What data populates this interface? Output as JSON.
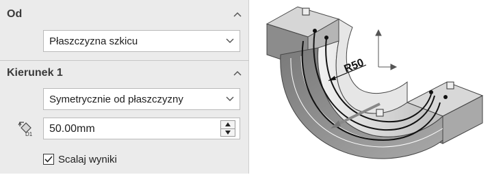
{
  "from_section": {
    "title": "Od",
    "start_condition": "Płaszczyzna szkicu"
  },
  "direction1_section": {
    "title": "Kierunek 1",
    "end_condition": "Symetrycznie od płaszczyzny",
    "depth_value": "50.00mm",
    "depth_icon_label": "D1"
  },
  "merge_result": {
    "label": "Scalaj wyniki",
    "checked": true
  },
  "model_view": {
    "dimension_label": "R50"
  },
  "icons": {
    "collapse": "chevron-up-icon",
    "dropdown": "chevron-down-icon",
    "depth": "depth-dimension-icon",
    "spin_up": "arrow-up-icon",
    "spin_down": "arrow-down-icon",
    "check": "checkmark-icon"
  }
}
